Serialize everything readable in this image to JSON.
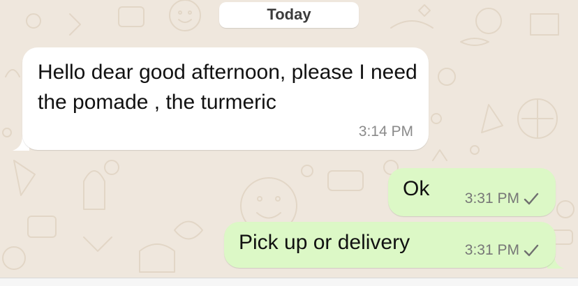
{
  "conversation": {
    "date_separator": "Today"
  },
  "messages": [
    {
      "direction": "incoming",
      "text": "Hello dear good afternoon, please I need the pomade , the turmeric",
      "time": "3:14 PM"
    },
    {
      "direction": "outgoing",
      "text": "Ok",
      "time": "3:31 PM",
      "status_icon": "check-icon"
    },
    {
      "direction": "outgoing",
      "text": "Pick up or delivery",
      "time": "3:31 PM",
      "status_icon": "check-icon"
    }
  ],
  "colors": {
    "background": "#efe7dd",
    "incoming_bubble": "#ffffff",
    "outgoing_bubble": "#dcf8c6",
    "timestamp": "#8a8a8a"
  }
}
